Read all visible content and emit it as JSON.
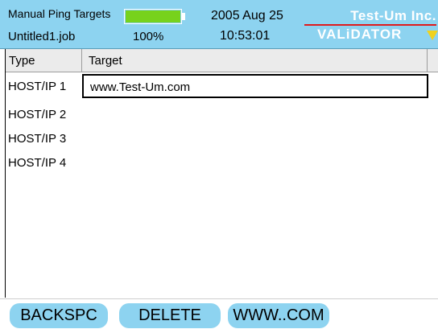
{
  "header": {
    "title": "Manual Ping Targets",
    "file": "Untitled1.job",
    "battery_percent": "100%",
    "battery_level": 1.0,
    "date": "2005 Aug 25",
    "time": "10:53:01",
    "brand": "Test-Um Inc.",
    "product": "VALiDATOR"
  },
  "table": {
    "columns": [
      "Type",
      "Target"
    ],
    "rows": [
      {
        "type": "HOST/IP  1",
        "target": "www.Test-Um.com",
        "selected": true
      },
      {
        "type": "HOST/IP  2",
        "target": ""
      },
      {
        "type": "HOST/IP  3",
        "target": ""
      },
      {
        "type": "HOST/IP  4",
        "target": ""
      }
    ]
  },
  "footer": {
    "buttons": [
      "BACKSPC",
      "DELETE",
      "WWW..COM"
    ]
  },
  "colors": {
    "header_bg": "#8dd3f0",
    "battery_fill": "#77d21c",
    "brand_line": "#e0191b",
    "arrow": "#f0d21e",
    "button_bg": "#8dd3f0"
  }
}
